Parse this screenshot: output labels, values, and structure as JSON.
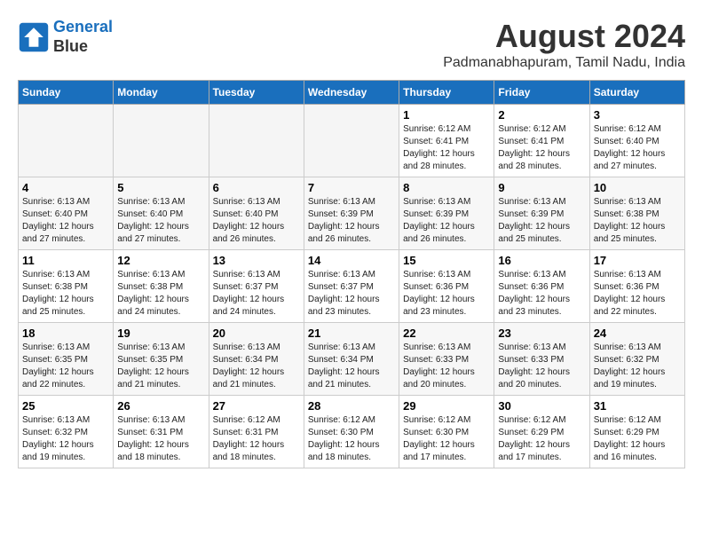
{
  "header": {
    "logo_line1": "General",
    "logo_line2": "Blue",
    "month_year": "August 2024",
    "location": "Padmanabhapuram, Tamil Nadu, India"
  },
  "days_of_week": [
    "Sunday",
    "Monday",
    "Tuesday",
    "Wednesday",
    "Thursday",
    "Friday",
    "Saturday"
  ],
  "weeks": [
    [
      {
        "day": "",
        "info": ""
      },
      {
        "day": "",
        "info": ""
      },
      {
        "day": "",
        "info": ""
      },
      {
        "day": "",
        "info": ""
      },
      {
        "day": "1",
        "info": "Sunrise: 6:12 AM\nSunset: 6:41 PM\nDaylight: 12 hours\nand 28 minutes."
      },
      {
        "day": "2",
        "info": "Sunrise: 6:12 AM\nSunset: 6:41 PM\nDaylight: 12 hours\nand 28 minutes."
      },
      {
        "day": "3",
        "info": "Sunrise: 6:12 AM\nSunset: 6:40 PM\nDaylight: 12 hours\nand 27 minutes."
      }
    ],
    [
      {
        "day": "4",
        "info": "Sunrise: 6:13 AM\nSunset: 6:40 PM\nDaylight: 12 hours\nand 27 minutes."
      },
      {
        "day": "5",
        "info": "Sunrise: 6:13 AM\nSunset: 6:40 PM\nDaylight: 12 hours\nand 27 minutes."
      },
      {
        "day": "6",
        "info": "Sunrise: 6:13 AM\nSunset: 6:40 PM\nDaylight: 12 hours\nand 26 minutes."
      },
      {
        "day": "7",
        "info": "Sunrise: 6:13 AM\nSunset: 6:39 PM\nDaylight: 12 hours\nand 26 minutes."
      },
      {
        "day": "8",
        "info": "Sunrise: 6:13 AM\nSunset: 6:39 PM\nDaylight: 12 hours\nand 26 minutes."
      },
      {
        "day": "9",
        "info": "Sunrise: 6:13 AM\nSunset: 6:39 PM\nDaylight: 12 hours\nand 25 minutes."
      },
      {
        "day": "10",
        "info": "Sunrise: 6:13 AM\nSunset: 6:38 PM\nDaylight: 12 hours\nand 25 minutes."
      }
    ],
    [
      {
        "day": "11",
        "info": "Sunrise: 6:13 AM\nSunset: 6:38 PM\nDaylight: 12 hours\nand 25 minutes."
      },
      {
        "day": "12",
        "info": "Sunrise: 6:13 AM\nSunset: 6:38 PM\nDaylight: 12 hours\nand 24 minutes."
      },
      {
        "day": "13",
        "info": "Sunrise: 6:13 AM\nSunset: 6:37 PM\nDaylight: 12 hours\nand 24 minutes."
      },
      {
        "day": "14",
        "info": "Sunrise: 6:13 AM\nSunset: 6:37 PM\nDaylight: 12 hours\nand 23 minutes."
      },
      {
        "day": "15",
        "info": "Sunrise: 6:13 AM\nSunset: 6:36 PM\nDaylight: 12 hours\nand 23 minutes."
      },
      {
        "day": "16",
        "info": "Sunrise: 6:13 AM\nSunset: 6:36 PM\nDaylight: 12 hours\nand 23 minutes."
      },
      {
        "day": "17",
        "info": "Sunrise: 6:13 AM\nSunset: 6:36 PM\nDaylight: 12 hours\nand 22 minutes."
      }
    ],
    [
      {
        "day": "18",
        "info": "Sunrise: 6:13 AM\nSunset: 6:35 PM\nDaylight: 12 hours\nand 22 minutes."
      },
      {
        "day": "19",
        "info": "Sunrise: 6:13 AM\nSunset: 6:35 PM\nDaylight: 12 hours\nand 21 minutes."
      },
      {
        "day": "20",
        "info": "Sunrise: 6:13 AM\nSunset: 6:34 PM\nDaylight: 12 hours\nand 21 minutes."
      },
      {
        "day": "21",
        "info": "Sunrise: 6:13 AM\nSunset: 6:34 PM\nDaylight: 12 hours\nand 21 minutes."
      },
      {
        "day": "22",
        "info": "Sunrise: 6:13 AM\nSunset: 6:33 PM\nDaylight: 12 hours\nand 20 minutes."
      },
      {
        "day": "23",
        "info": "Sunrise: 6:13 AM\nSunset: 6:33 PM\nDaylight: 12 hours\nand 20 minutes."
      },
      {
        "day": "24",
        "info": "Sunrise: 6:13 AM\nSunset: 6:32 PM\nDaylight: 12 hours\nand 19 minutes."
      }
    ],
    [
      {
        "day": "25",
        "info": "Sunrise: 6:13 AM\nSunset: 6:32 PM\nDaylight: 12 hours\nand 19 minutes."
      },
      {
        "day": "26",
        "info": "Sunrise: 6:13 AM\nSunset: 6:31 PM\nDaylight: 12 hours\nand 18 minutes."
      },
      {
        "day": "27",
        "info": "Sunrise: 6:12 AM\nSunset: 6:31 PM\nDaylight: 12 hours\nand 18 minutes."
      },
      {
        "day": "28",
        "info": "Sunrise: 6:12 AM\nSunset: 6:30 PM\nDaylight: 12 hours\nand 18 minutes."
      },
      {
        "day": "29",
        "info": "Sunrise: 6:12 AM\nSunset: 6:30 PM\nDaylight: 12 hours\nand 17 minutes."
      },
      {
        "day": "30",
        "info": "Sunrise: 6:12 AM\nSunset: 6:29 PM\nDaylight: 12 hours\nand 17 minutes."
      },
      {
        "day": "31",
        "info": "Sunrise: 6:12 AM\nSunset: 6:29 PM\nDaylight: 12 hours\nand 16 minutes."
      }
    ]
  ]
}
